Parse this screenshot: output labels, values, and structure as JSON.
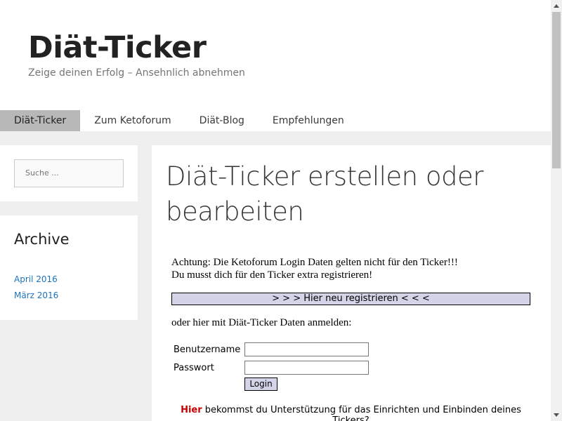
{
  "header": {
    "site_title": "Diät-Ticker",
    "tagline": "Zeige deinen Erfolg – Ansehnlich abnehmen"
  },
  "nav": {
    "items": [
      {
        "label": "Diät-Ticker",
        "active": true
      },
      {
        "label": "Zum Ketoforum",
        "active": false
      },
      {
        "label": "Diät-Blog",
        "active": false
      },
      {
        "label": "Empfehlungen",
        "active": false
      }
    ]
  },
  "sidebar": {
    "search_placeholder": "Suche ...",
    "archive_title": "Archive",
    "archive_links": [
      "April 2016",
      "März 2016"
    ]
  },
  "content": {
    "title": "Diät-Ticker erstellen oder bearbeiten",
    "notice_line1": "Achtung: Die Ketoforum Login Daten gelten nicht für den Ticker!!!",
    "notice_line2": "Du musst dich für den Ticker extra registrieren!",
    "register_label": "> > > Hier neu registrieren < < <",
    "login_intro": "oder hier mit Diät-Ticker Daten anmelden:",
    "username_label": "Benutzername",
    "username_value": "",
    "password_label": "Passwort",
    "password_value": "",
    "login_button": "Login",
    "help_link": "Hier",
    "help_text": " bekommst du Unterstützung für das Einrichten und Einbinden deines Tickers?"
  },
  "colors": {
    "link": "#1e73be",
    "nav_active_bg": "#b8b8b8",
    "register_bg": "#d4d4e8",
    "help_link": "#cc0000"
  }
}
